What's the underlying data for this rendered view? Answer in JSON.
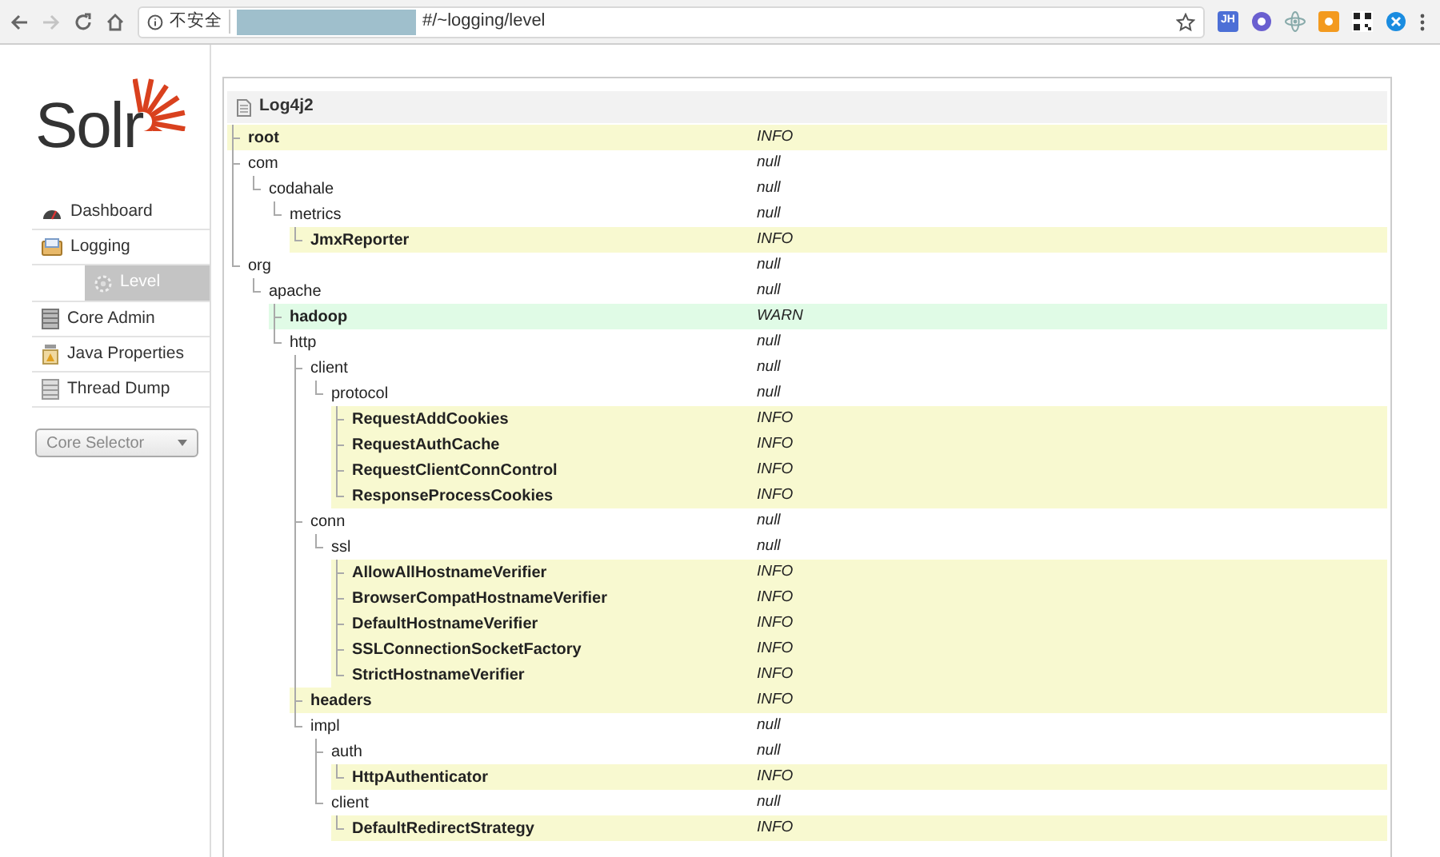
{
  "browser": {
    "security_label": "不安全",
    "url": "#/~logging/level",
    "extension_badge": "JH"
  },
  "logo": {
    "text": "Solr"
  },
  "sidebar": {
    "items": [
      {
        "label": "Dashboard",
        "selected": false
      },
      {
        "label": "Logging",
        "selected": false,
        "children": [
          {
            "label": "Level",
            "selected": true
          }
        ]
      },
      {
        "label": "Core Admin",
        "selected": false
      },
      {
        "label": "Java Properties",
        "selected": false
      },
      {
        "label": "Thread Dump",
        "selected": false
      }
    ],
    "core_selector": {
      "placeholder": "Core Selector"
    }
  },
  "panel": {
    "title": "Log4j2",
    "tree": [
      {
        "name": "root",
        "level": "INFO",
        "kind": "info"
      },
      {
        "name": "com",
        "level": "null",
        "kind": "plain",
        "children": [
          {
            "name": "codahale",
            "level": "null",
            "kind": "plain",
            "children": [
              {
                "name": "metrics",
                "level": "null",
                "kind": "plain",
                "children": [
                  {
                    "name": "JmxReporter",
                    "level": "INFO",
                    "kind": "info"
                  }
                ]
              }
            ]
          }
        ]
      },
      {
        "name": "org",
        "level": "null",
        "kind": "plain",
        "children": [
          {
            "name": "apache",
            "level": "null",
            "kind": "plain",
            "children": [
              {
                "name": "hadoop",
                "level": "WARN",
                "kind": "warn"
              },
              {
                "name": "http",
                "level": "null",
                "kind": "plain",
                "children": [
                  {
                    "name": "client",
                    "level": "null",
                    "kind": "plain",
                    "children": [
                      {
                        "name": "protocol",
                        "level": "null",
                        "kind": "plain",
                        "children": [
                          {
                            "name": "RequestAddCookies",
                            "level": "INFO",
                            "kind": "info"
                          },
                          {
                            "name": "RequestAuthCache",
                            "level": "INFO",
                            "kind": "info"
                          },
                          {
                            "name": "RequestClientConnControl",
                            "level": "INFO",
                            "kind": "info"
                          },
                          {
                            "name": "ResponseProcessCookies",
                            "level": "INFO",
                            "kind": "info"
                          }
                        ]
                      }
                    ]
                  },
                  {
                    "name": "conn",
                    "level": "null",
                    "kind": "plain",
                    "children": [
                      {
                        "name": "ssl",
                        "level": "null",
                        "kind": "plain",
                        "children": [
                          {
                            "name": "AllowAllHostnameVerifier",
                            "level": "INFO",
                            "kind": "info"
                          },
                          {
                            "name": "BrowserCompatHostnameVerifier",
                            "level": "INFO",
                            "kind": "info"
                          },
                          {
                            "name": "DefaultHostnameVerifier",
                            "level": "INFO",
                            "kind": "info"
                          },
                          {
                            "name": "SSLConnectionSocketFactory",
                            "level": "INFO",
                            "kind": "info"
                          },
                          {
                            "name": "StrictHostnameVerifier",
                            "level": "INFO",
                            "kind": "info"
                          }
                        ]
                      }
                    ]
                  },
                  {
                    "name": "headers",
                    "level": "INFO",
                    "kind": "info"
                  },
                  {
                    "name": "impl",
                    "level": "null",
                    "kind": "plain",
                    "children": [
                      {
                        "name": "auth",
                        "level": "null",
                        "kind": "plain",
                        "children": [
                          {
                            "name": "HttpAuthenticator",
                            "level": "INFO",
                            "kind": "info"
                          }
                        ]
                      },
                      {
                        "name": "client",
                        "level": "null",
                        "kind": "plain",
                        "children": [
                          {
                            "name": "DefaultRedirectStrategy",
                            "level": "INFO",
                            "kind": "info"
                          }
                        ]
                      }
                    ]
                  }
                ]
              }
            ]
          }
        ]
      }
    ]
  }
}
